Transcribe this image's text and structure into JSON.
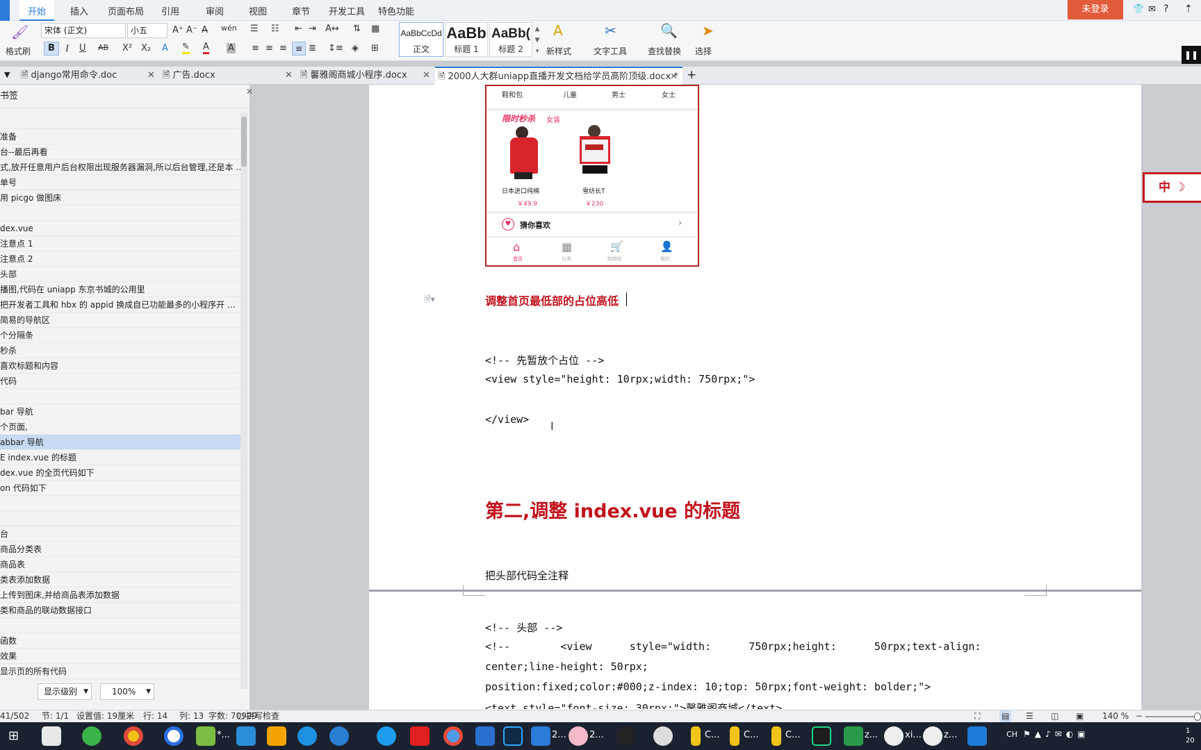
{
  "menu": {
    "items": [
      "开始",
      "插入",
      "页面布局",
      "引用",
      "审阅",
      "视图",
      "章节",
      "开发工具",
      "特色功能"
    ],
    "login": "未登录"
  },
  "toolbar": {
    "format_painter": "格式刷",
    "font_name": "宋体 (正文)",
    "font_size": "小五",
    "styles": [
      {
        "sample": "AaBbCcDd",
        "label": "正文"
      },
      {
        "sample": "AaBb",
        "label": "标题 1"
      },
      {
        "sample": "AaBb(",
        "label": "标题 2"
      }
    ],
    "new_style": "新样式",
    "text_tools": "文字工具",
    "find_replace": "查找替换",
    "select": "选择"
  },
  "tabs": [
    {
      "title": "django常用命令.doc",
      "active": false
    },
    {
      "title": "广告.docx",
      "active": false
    },
    {
      "title": "馨雅阁商城小程序.docx",
      "active": false
    },
    {
      "title": "2000人大群uniapp直播开发文档给学员高阶顶级.docx *",
      "active": true
    }
  ],
  "sidebar": {
    "title": "书签",
    "bookmarks": [
      "",
      "准备",
      "台--最后再看",
      "式,放开任意用户后台权限出现服务器漏洞,所以后台管理,还是本 …",
      "单号",
      "用 picgo 做图床",
      "",
      "dex.vue",
      "注意点 1",
      "注意点 2",
      "头部",
      "播图,代码在 uniapp 东京书城的公用里",
      "把开发者工具和 hbx 的 appid 换成自已功能最多的小程序开 …",
      "简易的导航区",
      "个分隔条",
      "秒杀",
      "喜欢标题和内容",
      "代码",
      "",
      "bar 导航",
      "个页面,",
      "abbar 导航",
      "E index.vue 的标题",
      "dex.vue 的全页代码如下",
      "on 代码如下",
      "",
      "",
      "台",
      "商品分类表",
      "商品表",
      "类表添加数据",
      "上传到图床,并给商品表添加数据",
      "类和商品的联动数据接口",
      "",
      "函数",
      "效果",
      "显示页的所有代码"
    ],
    "selected_index": 21,
    "level_select": "显示级别",
    "zoom_select": "100%"
  },
  "phone": {
    "categories": [
      "鞋和包",
      "儿童",
      "男士",
      "女士"
    ],
    "flash_title": "限时秒杀",
    "flash_tag": "女装",
    "products": [
      {
        "name": "日本进口纯棉",
        "price": "￥49.9"
      },
      {
        "name": "雪纺长T",
        "price": "￥230"
      }
    ],
    "guess_title": "猜你喜欢",
    "nav": [
      "首页",
      "分类",
      "购物车",
      "我的"
    ]
  },
  "doc": {
    "heading_small": "调整首页最低部的占位高低",
    "code1": [
      "<!-- 先暂放个占位 -->",
      "<view style=\"height: 10rpx;width: 750rpx;\">",
      "",
      "</view>"
    ],
    "heading_big": "第二,调整 index.vue 的标题",
    "para": "把头部代码全注释",
    "code2": [
      "<!-- 头部 -->",
      "<!--        <view      style=\"width:      750rpx;height:      50rpx;text-align:",
      "center;line-height: 50rpx;",
      "position:fixed;color:#000;z-index: 10;top: 50rpx;font-weight: bolder;\">",
      "<text style=\"font-size: 30rpx;\">馨雅阁商城</text>"
    ]
  },
  "seal_text": "中",
  "status": {
    "page": "41/502",
    "section": "节: 1/1",
    "setting": "设置值: 19厘米",
    "row": "行: 14",
    "col": "列: 13",
    "words": "字数: 70929",
    "spell": "拼写检查",
    "zoom": "140 %"
  },
  "taskbar": {
    "labels": [
      "*...",
      "2...",
      "2...",
      "C...",
      "C...",
      "C...",
      "z...",
      "xi...",
      "z..."
    ],
    "tray": "CH"
  }
}
